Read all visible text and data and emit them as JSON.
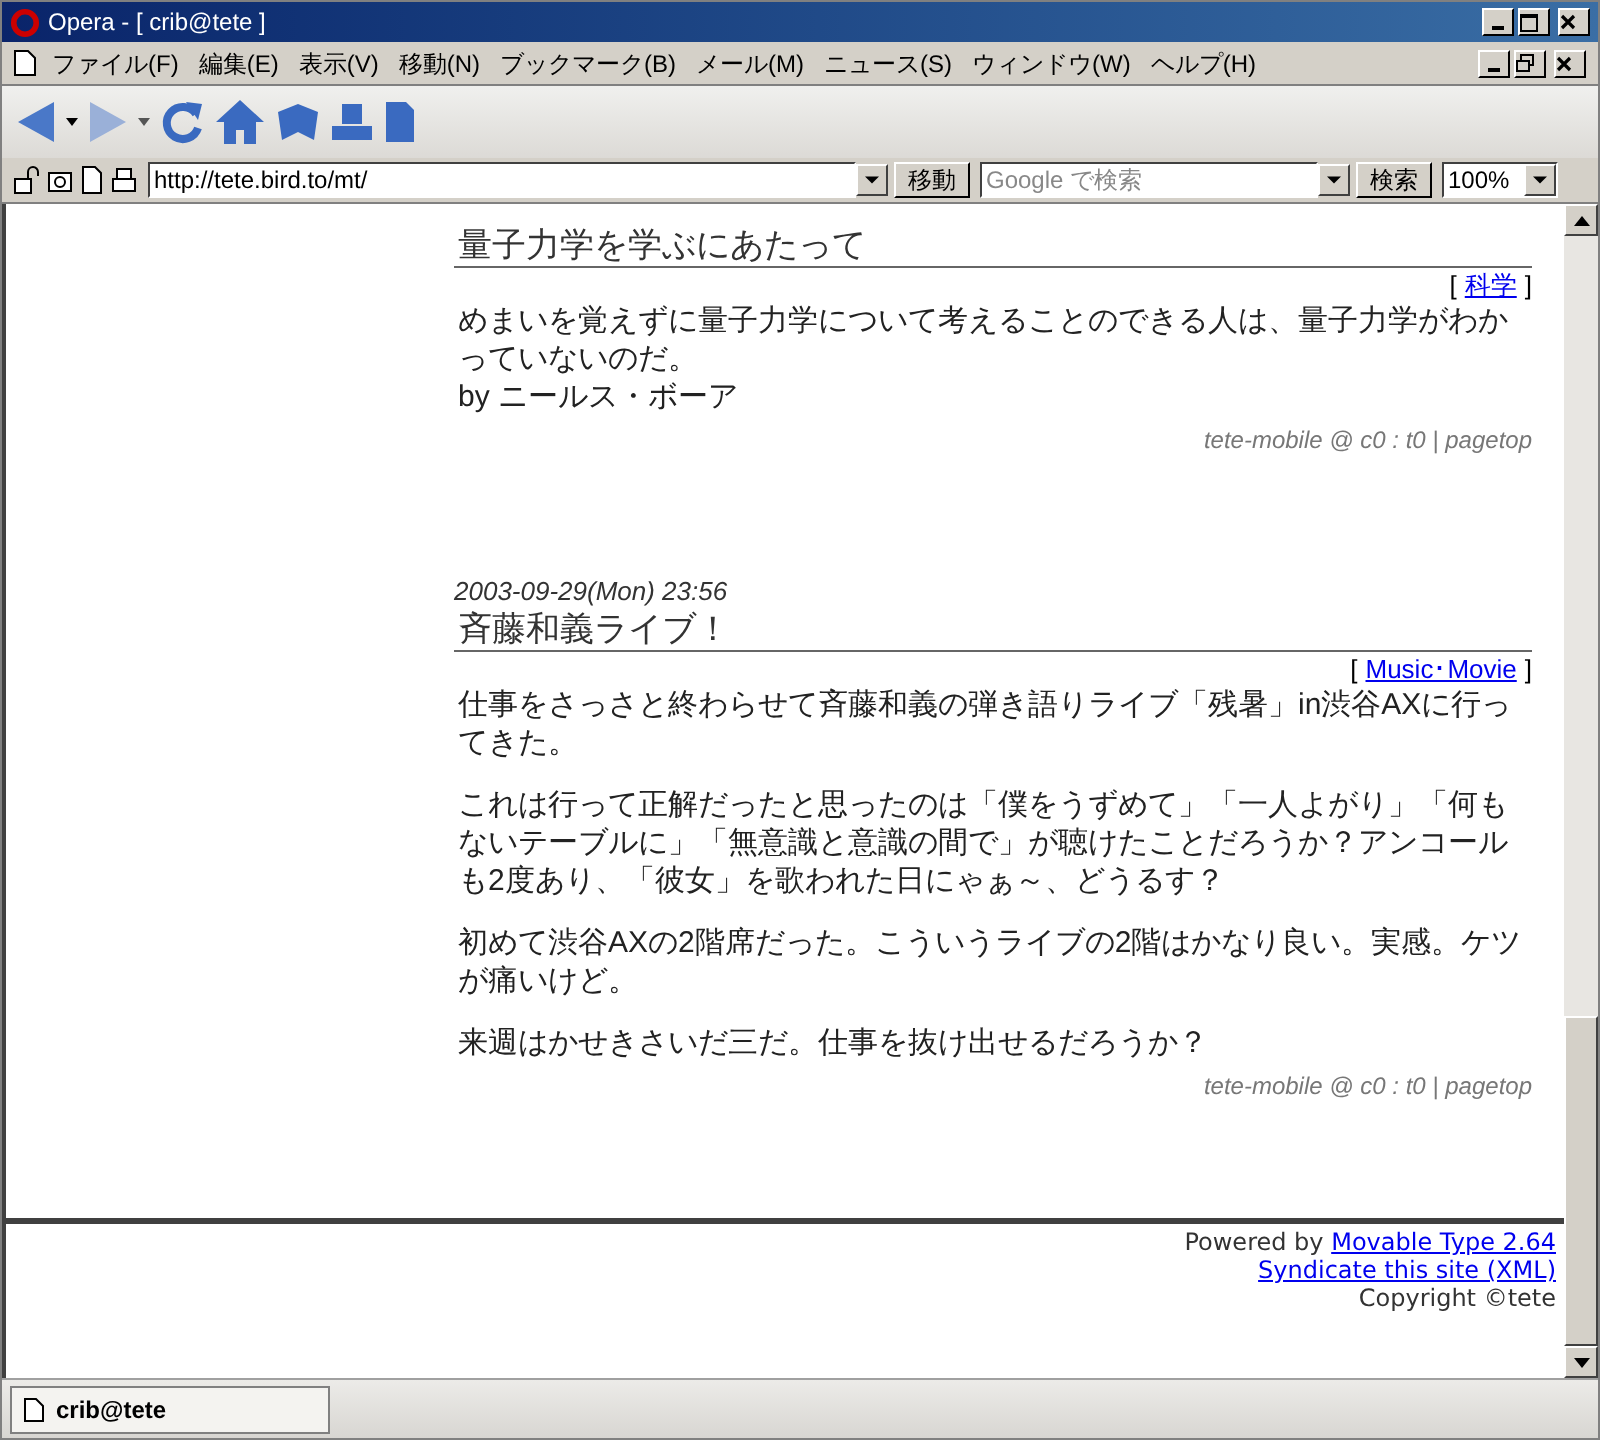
{
  "window": {
    "title": "Opera - [ crib@tete ]"
  },
  "menu": [
    "ファイル(F)",
    "編集(E)",
    "表示(V)",
    "移動(N)",
    "ブックマーク(B)",
    "メール(M)",
    "ニュース(S)",
    "ウィンドウ(W)",
    "ヘルプ(H)"
  ],
  "address": {
    "value": "http://tete.bird.to/mt/",
    "go": "移動"
  },
  "search": {
    "placeholder": "Google で検索",
    "button": "検索"
  },
  "zoom": "100%",
  "category_brackets": [
    "[",
    "]"
  ],
  "entries": [
    {
      "title": "量子力学を学ぶにあたって",
      "category": "科学",
      "paragraphs": [
        "めまいを覚えずに量子力学について考えることのできる人は、量子力学がわかっていないのだ。\nby ニールス・ボーア"
      ],
      "footer": "tete-mobile @ c0 : t0 | pagetop"
    },
    {
      "date": "2003-09-29(Mon) 23:56",
      "title": "斉藤和義ライブ！",
      "category": "Music･Movie",
      "paragraphs": [
        "仕事をさっさと終わらせて斉藤和義の弾き語りライブ「残暑」in渋谷AXに行ってきた。",
        "これは行って正解だったと思ったのは「僕をうずめて」「一人よがり」「何もないテーブルに」「無意識と意識の間で」が聴けたことだろうか？アンコールも2度あり、「彼女」を歌われた日にゃぁ～、どうるす？",
        "初めて渋谷AXの2階席だった。こういうライブの2階はかなり良い。実感。ケツが痛いけど。",
        "来週はかせきさいだ三だ。仕事を抜け出せるだろうか？"
      ],
      "footer": "tete-mobile @ c0 : t0 | pagetop"
    }
  ],
  "site_footer": {
    "powered_prefix": "Powered by",
    "powered_link": "Movable Type 2.64",
    "syndicate": "Syndicate this site (XML)",
    "copyright": "Copyright ©tete"
  },
  "tabs": [
    {
      "label": "crib@tete",
      "selected": true
    }
  ]
}
